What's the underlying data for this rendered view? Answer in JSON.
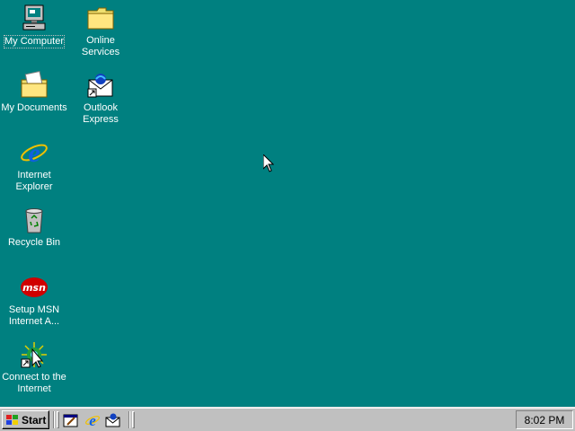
{
  "desktop": {
    "background_color": "#008080",
    "icons": [
      {
        "label": "My Computer",
        "icon": "my-computer-icon"
      },
      {
        "label": "Online Services",
        "icon": "folder-icon"
      },
      {
        "label": "My Documents",
        "icon": "my-documents-icon"
      },
      {
        "label": "Outlook Express",
        "icon": "outlook-express-icon"
      },
      {
        "label": "Internet Explorer",
        "icon": "internet-explorer-icon"
      },
      {
        "label": "Recycle Bin",
        "icon": "recycle-bin-icon"
      },
      {
        "label": "Setup MSN Internet A...",
        "icon": "msn-icon"
      },
      {
        "label": "Connect to the Internet",
        "icon": "connect-internet-icon"
      }
    ]
  },
  "taskbar": {
    "start_label": "Start",
    "quick_launch": [
      {
        "icon": "show-desktop-icon"
      },
      {
        "icon": "internet-explorer-icon"
      },
      {
        "icon": "outlook-express-icon"
      }
    ],
    "clock": "8:02 PM"
  }
}
